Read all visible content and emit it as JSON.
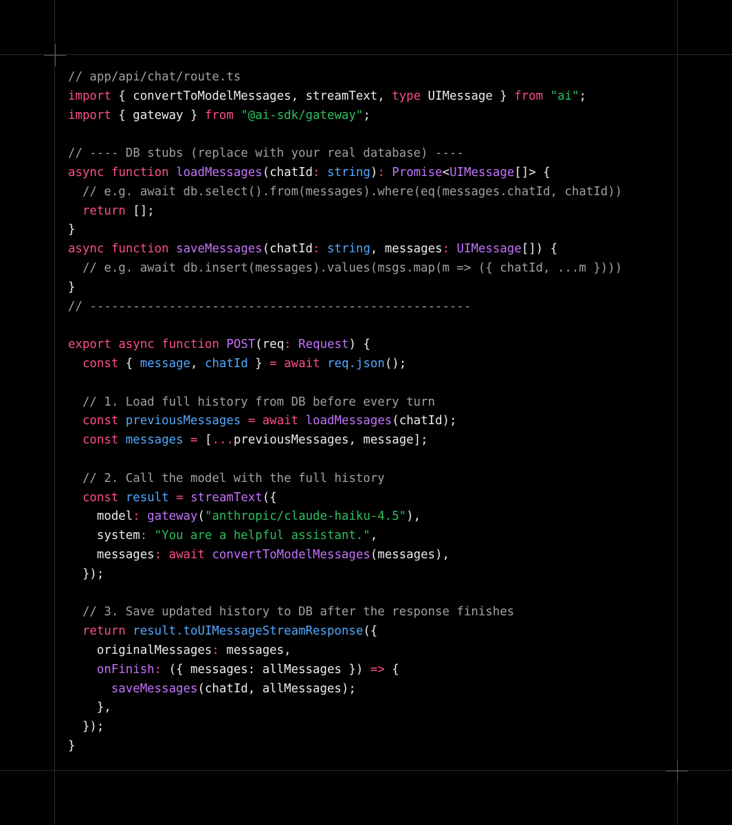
{
  "code": {
    "filename_comment": "// app/api/chat/route.ts",
    "colors": {
      "background": "#000000",
      "plain": "#ededed",
      "comment": "#a1a1a1",
      "keyword": "#ff4d8d",
      "function": "#c372fc",
      "string": "#2ebf5e",
      "variable": "#52a8ff"
    },
    "lines": [
      [
        {
          "t": "// app/api/chat/route.ts",
          "c": "comment"
        }
      ],
      [
        {
          "t": "import",
          "c": "keyword"
        },
        {
          "t": " { convertToModelMessages, streamText, ",
          "c": "plain"
        },
        {
          "t": "type",
          "c": "keyword"
        },
        {
          "t": " UIMessage } ",
          "c": "plain"
        },
        {
          "t": "from",
          "c": "keyword"
        },
        {
          "t": " ",
          "c": "plain"
        },
        {
          "t": "\"ai\"",
          "c": "string"
        },
        {
          "t": ";",
          "c": "plain"
        }
      ],
      [
        {
          "t": "import",
          "c": "keyword"
        },
        {
          "t": " { gateway } ",
          "c": "plain"
        },
        {
          "t": "from",
          "c": "keyword"
        },
        {
          "t": " ",
          "c": "plain"
        },
        {
          "t": "\"@ai-sdk/gateway\"",
          "c": "string"
        },
        {
          "t": ";",
          "c": "plain"
        }
      ],
      [],
      [
        {
          "t": "// ---- DB stubs (replace with your real database) ----",
          "c": "comment"
        }
      ],
      [
        {
          "t": "async",
          "c": "keyword"
        },
        {
          "t": " ",
          "c": "plain"
        },
        {
          "t": "function",
          "c": "keyword"
        },
        {
          "t": " ",
          "c": "plain"
        },
        {
          "t": "loadMessages",
          "c": "function"
        },
        {
          "t": "(chatId",
          "c": "plain"
        },
        {
          "t": ":",
          "c": "keyword"
        },
        {
          "t": " ",
          "c": "plain"
        },
        {
          "t": "string",
          "c": "variable"
        },
        {
          "t": ")",
          "c": "plain"
        },
        {
          "t": ":",
          "c": "keyword"
        },
        {
          "t": " ",
          "c": "plain"
        },
        {
          "t": "Promise",
          "c": "function"
        },
        {
          "t": "<",
          "c": "plain"
        },
        {
          "t": "UIMessage",
          "c": "function"
        },
        {
          "t": "[]> {",
          "c": "plain"
        }
      ],
      [
        {
          "t": "  // e.g. await db.select().from(messages).where(eq(messages.chatId, chatId))",
          "c": "comment"
        }
      ],
      [
        {
          "t": "  ",
          "c": "plain"
        },
        {
          "t": "return",
          "c": "keyword"
        },
        {
          "t": " [];",
          "c": "plain"
        }
      ],
      [
        {
          "t": "}",
          "c": "plain"
        }
      ],
      [
        {
          "t": "async",
          "c": "keyword"
        },
        {
          "t": " ",
          "c": "plain"
        },
        {
          "t": "function",
          "c": "keyword"
        },
        {
          "t": " ",
          "c": "plain"
        },
        {
          "t": "saveMessages",
          "c": "function"
        },
        {
          "t": "(chatId",
          "c": "plain"
        },
        {
          "t": ":",
          "c": "keyword"
        },
        {
          "t": " ",
          "c": "plain"
        },
        {
          "t": "string",
          "c": "variable"
        },
        {
          "t": ", messages",
          "c": "plain"
        },
        {
          "t": ":",
          "c": "keyword"
        },
        {
          "t": " ",
          "c": "plain"
        },
        {
          "t": "UIMessage",
          "c": "function"
        },
        {
          "t": "[]) {",
          "c": "plain"
        }
      ],
      [
        {
          "t": "  // e.g. await db.insert(messages).values(msgs.map(m => ({ chatId, ...m })))",
          "c": "comment"
        }
      ],
      [
        {
          "t": "}",
          "c": "plain"
        }
      ],
      [
        {
          "t": "// -----------------------------------------------------",
          "c": "comment"
        }
      ],
      [],
      [
        {
          "t": "export",
          "c": "keyword"
        },
        {
          "t": " ",
          "c": "plain"
        },
        {
          "t": "async",
          "c": "keyword"
        },
        {
          "t": " ",
          "c": "plain"
        },
        {
          "t": "function",
          "c": "keyword"
        },
        {
          "t": " ",
          "c": "plain"
        },
        {
          "t": "POST",
          "c": "function"
        },
        {
          "t": "(req",
          "c": "plain"
        },
        {
          "t": ":",
          "c": "keyword"
        },
        {
          "t": " ",
          "c": "plain"
        },
        {
          "t": "Request",
          "c": "function"
        },
        {
          "t": ") {",
          "c": "plain"
        }
      ],
      [
        {
          "t": "  ",
          "c": "plain"
        },
        {
          "t": "const",
          "c": "keyword"
        },
        {
          "t": " { ",
          "c": "plain"
        },
        {
          "t": "message",
          "c": "variable"
        },
        {
          "t": ", ",
          "c": "plain"
        },
        {
          "t": "chatId",
          "c": "variable"
        },
        {
          "t": " } ",
          "c": "plain"
        },
        {
          "t": "=",
          "c": "keyword"
        },
        {
          "t": " ",
          "c": "plain"
        },
        {
          "t": "await",
          "c": "keyword"
        },
        {
          "t": " ",
          "c": "plain"
        },
        {
          "t": "req.json",
          "c": "variable"
        },
        {
          "t": "();",
          "c": "plain"
        }
      ],
      [],
      [
        {
          "t": "  // 1. Load full history from DB before every turn",
          "c": "comment"
        }
      ],
      [
        {
          "t": "  ",
          "c": "plain"
        },
        {
          "t": "const",
          "c": "keyword"
        },
        {
          "t": " ",
          "c": "plain"
        },
        {
          "t": "previousMessages",
          "c": "variable"
        },
        {
          "t": " ",
          "c": "plain"
        },
        {
          "t": "=",
          "c": "keyword"
        },
        {
          "t": " ",
          "c": "plain"
        },
        {
          "t": "await",
          "c": "keyword"
        },
        {
          "t": " ",
          "c": "plain"
        },
        {
          "t": "loadMessages",
          "c": "function"
        },
        {
          "t": "(chatId);",
          "c": "plain"
        }
      ],
      [
        {
          "t": "  ",
          "c": "plain"
        },
        {
          "t": "const",
          "c": "keyword"
        },
        {
          "t": " ",
          "c": "plain"
        },
        {
          "t": "messages",
          "c": "variable"
        },
        {
          "t": " ",
          "c": "plain"
        },
        {
          "t": "=",
          "c": "keyword"
        },
        {
          "t": " [",
          "c": "plain"
        },
        {
          "t": "...",
          "c": "keyword"
        },
        {
          "t": "previousMessages, message];",
          "c": "plain"
        }
      ],
      [],
      [
        {
          "t": "  // 2. Call the model with the full history",
          "c": "comment"
        }
      ],
      [
        {
          "t": "  ",
          "c": "plain"
        },
        {
          "t": "const",
          "c": "keyword"
        },
        {
          "t": " ",
          "c": "plain"
        },
        {
          "t": "result",
          "c": "variable"
        },
        {
          "t": " ",
          "c": "plain"
        },
        {
          "t": "=",
          "c": "keyword"
        },
        {
          "t": " ",
          "c": "plain"
        },
        {
          "t": "streamText",
          "c": "function"
        },
        {
          "t": "({",
          "c": "plain"
        }
      ],
      [
        {
          "t": "    model",
          "c": "plain"
        },
        {
          "t": ":",
          "c": "keyword"
        },
        {
          "t": " ",
          "c": "plain"
        },
        {
          "t": "gateway",
          "c": "function"
        },
        {
          "t": "(",
          "c": "plain"
        },
        {
          "t": "\"anthropic/claude-haiku-4.5\"",
          "c": "string"
        },
        {
          "t": "),",
          "c": "plain"
        }
      ],
      [
        {
          "t": "    system",
          "c": "plain"
        },
        {
          "t": ":",
          "c": "keyword"
        },
        {
          "t": " ",
          "c": "plain"
        },
        {
          "t": "\"You are a helpful assistant.\"",
          "c": "string"
        },
        {
          "t": ",",
          "c": "plain"
        }
      ],
      [
        {
          "t": "    messages",
          "c": "plain"
        },
        {
          "t": ":",
          "c": "keyword"
        },
        {
          "t": " ",
          "c": "plain"
        },
        {
          "t": "await",
          "c": "keyword"
        },
        {
          "t": " ",
          "c": "plain"
        },
        {
          "t": "convertToModelMessages",
          "c": "function"
        },
        {
          "t": "(messages),",
          "c": "plain"
        }
      ],
      [
        {
          "t": "  });",
          "c": "plain"
        }
      ],
      [],
      [
        {
          "t": "  // 3. Save updated history to DB after the response finishes",
          "c": "comment"
        }
      ],
      [
        {
          "t": "  ",
          "c": "plain"
        },
        {
          "t": "return",
          "c": "keyword"
        },
        {
          "t": " ",
          "c": "plain"
        },
        {
          "t": "result.toUIMessageStreamResponse",
          "c": "variable"
        },
        {
          "t": "({",
          "c": "plain"
        }
      ],
      [
        {
          "t": "    originalMessages",
          "c": "plain"
        },
        {
          "t": ":",
          "c": "keyword"
        },
        {
          "t": " messages,",
          "c": "plain"
        }
      ],
      [
        {
          "t": "    ",
          "c": "plain"
        },
        {
          "t": "onFinish",
          "c": "function"
        },
        {
          "t": ":",
          "c": "keyword"
        },
        {
          "t": " ({ messages: allMessages }) ",
          "c": "plain"
        },
        {
          "t": "=>",
          "c": "keyword"
        },
        {
          "t": " {",
          "c": "plain"
        }
      ],
      [
        {
          "t": "      ",
          "c": "plain"
        },
        {
          "t": "saveMessages",
          "c": "function"
        },
        {
          "t": "(chatId, allMessages);",
          "c": "plain"
        }
      ],
      [
        {
          "t": "    },",
          "c": "plain"
        }
      ],
      [
        {
          "t": "  });",
          "c": "plain"
        }
      ],
      [
        {
          "t": "}",
          "c": "plain"
        }
      ]
    ]
  }
}
